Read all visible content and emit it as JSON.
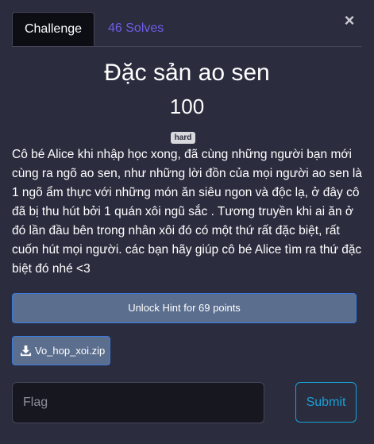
{
  "close": {
    "icon": "close-icon",
    "glyph": "×"
  },
  "tabs": [
    {
      "label": "Challenge",
      "active": true
    },
    {
      "label": "46 Solves",
      "active": false
    }
  ],
  "challenge": {
    "name": "Đặc sản ao sen",
    "value": "100",
    "difficulty": "hard",
    "description": "Cô bé Alice khi nhập học xong, đã cùng những người bạn mới cùng ra ngõ ao sen, như những lời đồn của mọi người ao sen là 1 ngõ ẩm thực với những món ăn siêu ngon và độc lạ, ở đây cô đã bị thu hút bởi 1 quán xôi ngũ sắc . Tương truyền khi ai ăn ở đó lần đầu bên trong nhân xôi đó có một thứ rất đặc biệt, rất cuốn hút mọi người. các bạn hãy giúp cô bé Alice tìm ra thứ đặc biệt đó nhé <3"
  },
  "hint": {
    "label": "Unlock Hint for 69 points"
  },
  "file": {
    "name": "Vo_hop_xoi.zip",
    "icon": "download-icon"
  },
  "flag": {
    "placeholder": "Flag",
    "value": ""
  },
  "submit": {
    "label": "Submit"
  },
  "colors": {
    "background": "#2b2c3e",
    "active_tab": "#0d0e14",
    "solves_link": "#6f5ce8",
    "button_bg": "#5b6e8e",
    "button_border": "#3a7be0",
    "submit_accent": "#1aa0d6",
    "badge_bg": "#d8d9dc"
  }
}
